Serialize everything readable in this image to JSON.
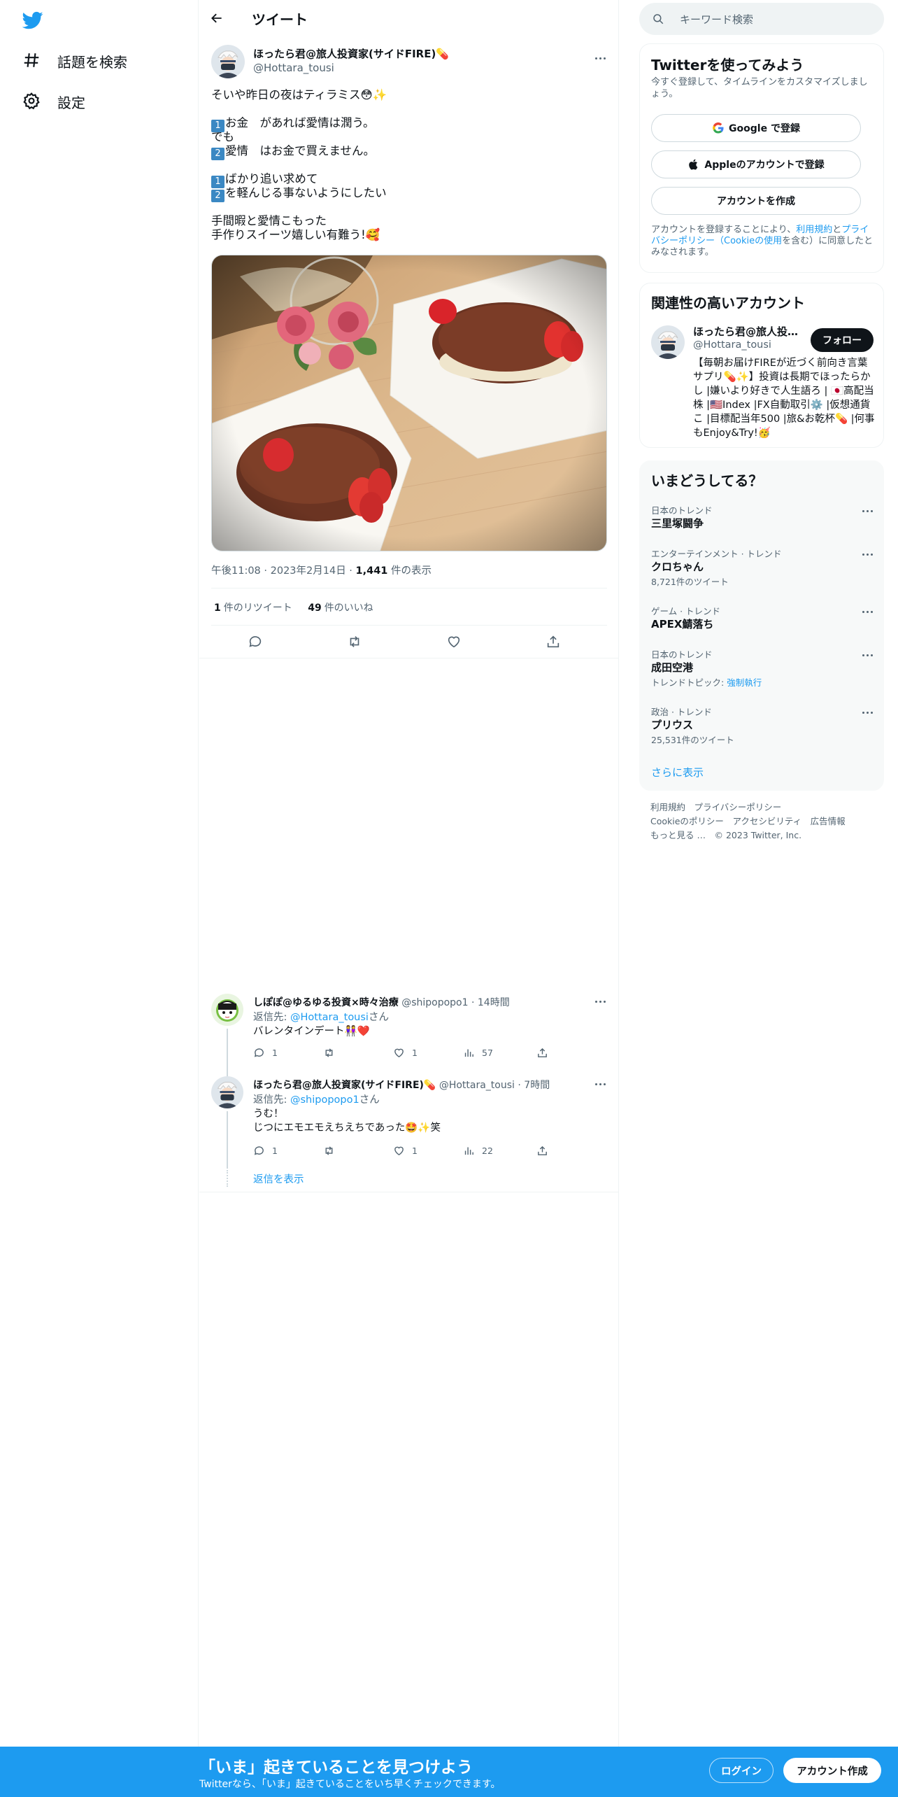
{
  "colors": {
    "accent": "#1d9bf0",
    "text": "#0f1419",
    "muted": "#536471",
    "keycap": "#3b88c3"
  },
  "sidebar": {
    "logo_icon": "twitter-bird-icon",
    "items": [
      {
        "label": "話題を検索",
        "icon": "hashtag-icon"
      },
      {
        "label": "設定",
        "icon": "gear-icon"
      }
    ]
  },
  "header": {
    "title": "ツイート",
    "back_icon": "arrow-left-icon"
  },
  "tweet": {
    "author_name": "ほったら君@旅人投資家(サイドFIRE)💊",
    "author_handle": "@Hottara_tousi",
    "body_lines": [
      "そいや昨日の夜はティラミス😳✨",
      "",
      "[1]お金　があれば愛情は潤う。",
      "でも",
      "[2]愛情　はお金で買えません。",
      "",
      "[1]ばかり追い求めて",
      "[2]を軽んじる事ないようにしたい",
      "",
      "手間暇と愛情こもった",
      "手作りスイーツ嬉しい有難う!🥰"
    ],
    "time": "午後11:08",
    "date": "2023年2月14日",
    "views_count": "1,441",
    "views_label": "件の表示",
    "retweets_count": "1",
    "retweets_label": "件のリツイート",
    "likes_count": "49",
    "likes_label": "件のいいね"
  },
  "replies": [
    {
      "name": "しぽぽ@ゆるゆる投資×時々治療",
      "handle": "@shipopopo1",
      "time": "14時間",
      "reply_to_prefix": "返信先: ",
      "reply_to_handle": "@Hottara_tousi",
      "reply_to_suffix": "さん",
      "text_lines": [
        "バレンタインデート👭❤️"
      ],
      "replies": "1",
      "retweets": "",
      "likes": "1",
      "views": "57"
    },
    {
      "name": "ほったら君@旅人投資家(サイドFIRE)💊",
      "handle": "@Hottara_tousi",
      "time": "7時間",
      "reply_to_prefix": "返信先: ",
      "reply_to_handle": "@shipopopo1",
      "reply_to_suffix": "さん",
      "text_lines": [
        "うむ！",
        "じつにエモエモえちえちであった🤩✨笑"
      ],
      "replies": "1",
      "retweets": "",
      "likes": "1",
      "views": "22"
    }
  ],
  "show_replies": "返信を表示",
  "search": {
    "placeholder": "キーワード検索"
  },
  "signup": {
    "title": "Twitterを使ってみよう",
    "subtitle": "今すぐ登録して、タイムラインをカスタマイズしましょう。",
    "google": "Google で登録",
    "apple": "Appleのアカウントで登録",
    "create": "アカウントを作成",
    "legal_prefix": "アカウントを登録することにより、",
    "legal_terms": "利用規約",
    "legal_and": "と",
    "legal_privacy": "プライバシーポリシー",
    "legal_cookie": "（Cookieの使用",
    "legal_suffix": "を含む）に同意したとみなされます。"
  },
  "recommend": {
    "title": "関連性の高いアカウント",
    "name": "ほったら君@旅人投資家(サイドFIRE)💊",
    "handle": "@Hottara_tousi",
    "follow": "フォロー",
    "bio": "【毎朝お届けFIREが近づく前向き言葉サプリ💊✨】投資は長期でほったらかし |嫌いより好きで人生語ろ | 🇯🇵高配当株 |🇺🇸Index |FX自動取引⚙️ |仮想通貨こ |目標配当年500 |旅&お乾杯💊 |何事もEnjoy&Try!🥳"
  },
  "trends": {
    "title": "いまどうしてる？",
    "items": [
      {
        "context": "日本のトレンド",
        "title": "三里塚闘争",
        "count": ""
      },
      {
        "context": "エンターテインメント · トレンド",
        "title": "クロちゃん",
        "count": "8,721件のツイート"
      },
      {
        "context": "ゲーム · トレンド",
        "title": "APEX鯖落ち",
        "count": ""
      },
      {
        "context": "日本のトレンド",
        "title": "成田空港",
        "count_prefix": "トレンドトピック: ",
        "count_link": "強制執行"
      },
      {
        "context": "政治 · トレンド",
        "title": "プリウス",
        "count": "25,531件のツイート"
      }
    ],
    "show_more": "さらに表示"
  },
  "footer": {
    "row1": [
      "利用規約",
      "プライバシーポリシー"
    ],
    "row2": [
      "Cookieのポリシー",
      "アクセシビリティ",
      "広告情報"
    ],
    "row3": [
      "もっと見る …",
      "© 2023 Twitter, Inc."
    ]
  },
  "banner": {
    "headline": "「いま」起きていることを見つけよう",
    "sub": "Twitterなら、「いま」起きていることをいち早くチェックできます。",
    "login": "ログイン",
    "create": "アカウント作成"
  }
}
